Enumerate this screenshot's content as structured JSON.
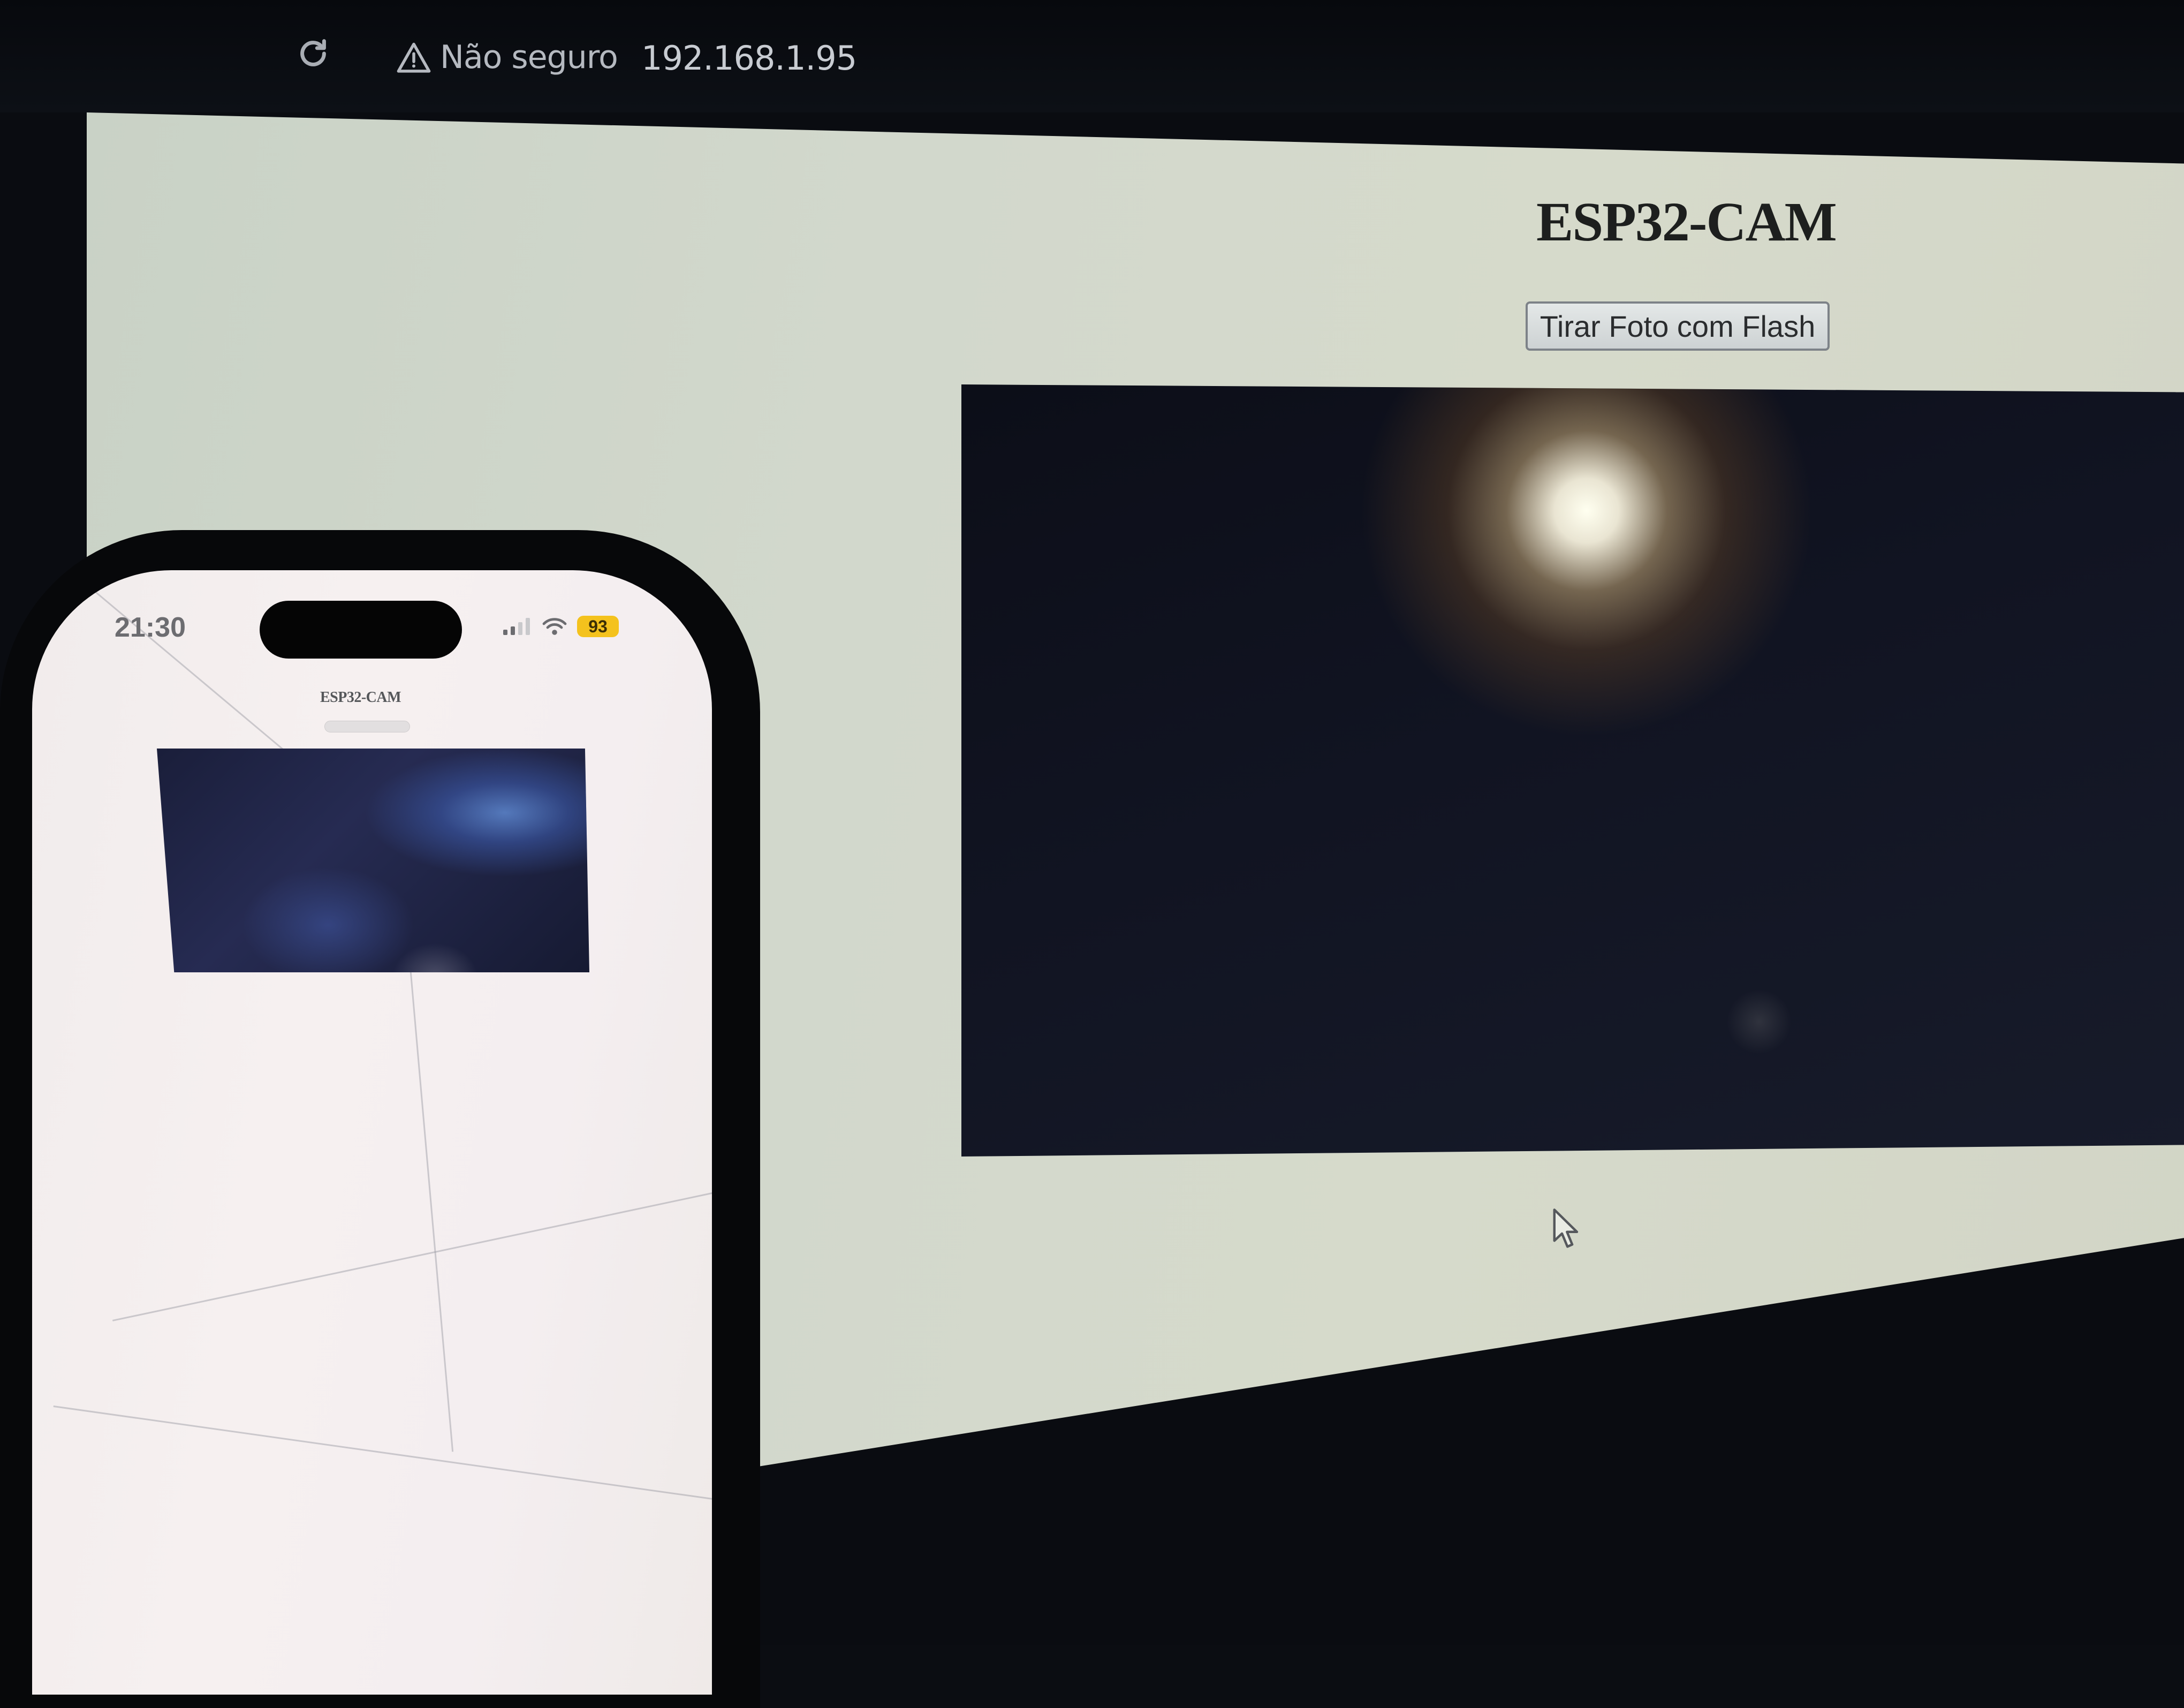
{
  "browser": {
    "security_label": "Não seguro",
    "url": "192.168.1.95"
  },
  "page": {
    "title": "ESP32-CAM",
    "flash_button_label": "Tirar Foto com Flash"
  },
  "phone": {
    "status_time": "21:30",
    "battery_level": "93",
    "page_title": "ESP32-CAM"
  },
  "icons": {
    "reload": "reload-icon",
    "warning": "warning-triangle-icon",
    "cursor": "mouse-cursor-icon",
    "signal": "cellular-signal-icon",
    "wifi": "wifi-icon"
  },
  "colors": {
    "page_background": "#d2d8cc",
    "battery_badge": "#f4c21d",
    "title_text": "#1d1f1e"
  }
}
